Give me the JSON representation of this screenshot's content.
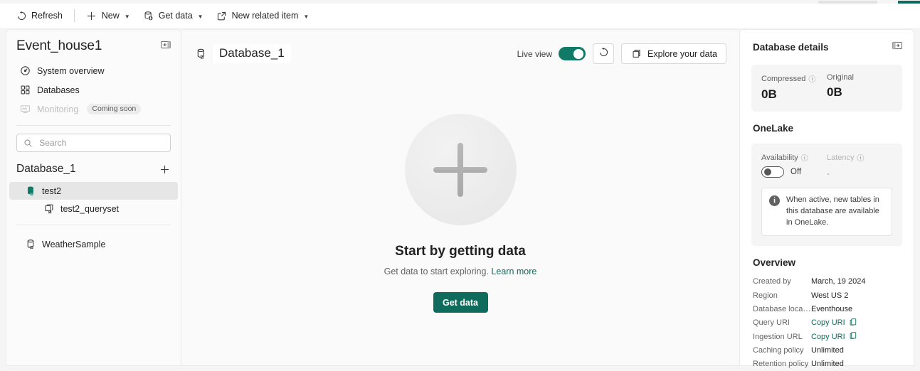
{
  "commandbar": {
    "items": [
      {
        "label": "Refresh",
        "icon": "refresh-icon",
        "caret": false
      },
      {
        "label": "New",
        "icon": "plus-icon",
        "caret": true
      },
      {
        "label": "Get data",
        "icon": "get-data-icon",
        "caret": true
      },
      {
        "label": "New related item",
        "icon": "external-link-icon",
        "caret": true
      }
    ]
  },
  "sidebar": {
    "title": "Event_house1",
    "collapse_icon": "panel-collapse-icon",
    "nav": [
      {
        "label": "System overview",
        "icon": "gauge-icon",
        "badge": ""
      },
      {
        "label": "Databases",
        "icon": "grid-icon",
        "badge": ""
      },
      {
        "label": "Monitoring",
        "icon": "monitor-icon",
        "badge": "Coming soon"
      }
    ],
    "search": {
      "placeholder": "Search",
      "value": "",
      "icon": "search-icon"
    },
    "tree_header": {
      "title": "Database_1",
      "add_icon": "plus-icon"
    },
    "tree": [
      {
        "label": "test2",
        "icon": "database-shortcut-icon",
        "level": 1,
        "selected": true
      },
      {
        "label": "test2_queryset",
        "icon": "queryset-icon",
        "level": 2,
        "selected": false
      },
      {
        "label": "WeatherSample",
        "icon": "database-shortcut-icon",
        "level": 1,
        "selected": false
      }
    ]
  },
  "main": {
    "db_icon": "database-shortcut-icon",
    "db_name": "Database_1",
    "live_view": {
      "label": "Live view",
      "state": "on"
    },
    "refresh_icon": "refresh-icon",
    "explore_button": {
      "label": "Explore your data",
      "icon": "explore-icon"
    },
    "empty_state": {
      "icon": "plus-circle-icon",
      "title": "Start by getting data",
      "subtitle": "Get data to start exploring.",
      "link": "Learn more",
      "button": "Get data"
    }
  },
  "rail": {
    "title": "Database details",
    "expand_icon": "panel-expand-icon",
    "metrics": [
      {
        "label": "Compressed",
        "info": true,
        "value": "0B"
      },
      {
        "label": "Original",
        "info": false,
        "value": "0B"
      }
    ],
    "onelake": {
      "title": "OneLake",
      "availability": {
        "label": "Availability",
        "info": true,
        "state": "Off"
      },
      "latency": {
        "label": "Latency",
        "info": true,
        "value": "-"
      },
      "note": "When active, new tables in this database are available in OneLake."
    },
    "overview": {
      "title": "Overview",
      "rows": [
        {
          "key": "Created by",
          "value": "March, 19 2024",
          "link": false,
          "copy": false
        },
        {
          "key": "Region",
          "value": "West US 2",
          "link": false,
          "copy": false
        },
        {
          "key": "Database locati...",
          "value": "Eventhouse",
          "link": false,
          "copy": false
        },
        {
          "key": "Query URI",
          "value": "Copy URI",
          "link": true,
          "copy": true
        },
        {
          "key": "Ingestion URL",
          "value": "Copy URI",
          "link": true,
          "copy": true
        },
        {
          "key": "Caching policy",
          "value": "Unlimited",
          "link": false,
          "copy": false
        },
        {
          "key": "Retention policy",
          "value": "Unlimited",
          "link": false,
          "copy": false
        }
      ]
    }
  },
  "theme": {
    "accent": "#0f6b5c",
    "toggle_on": "#107a67",
    "link": "#0f6b5c",
    "selected_row": "#e6e6e6"
  }
}
